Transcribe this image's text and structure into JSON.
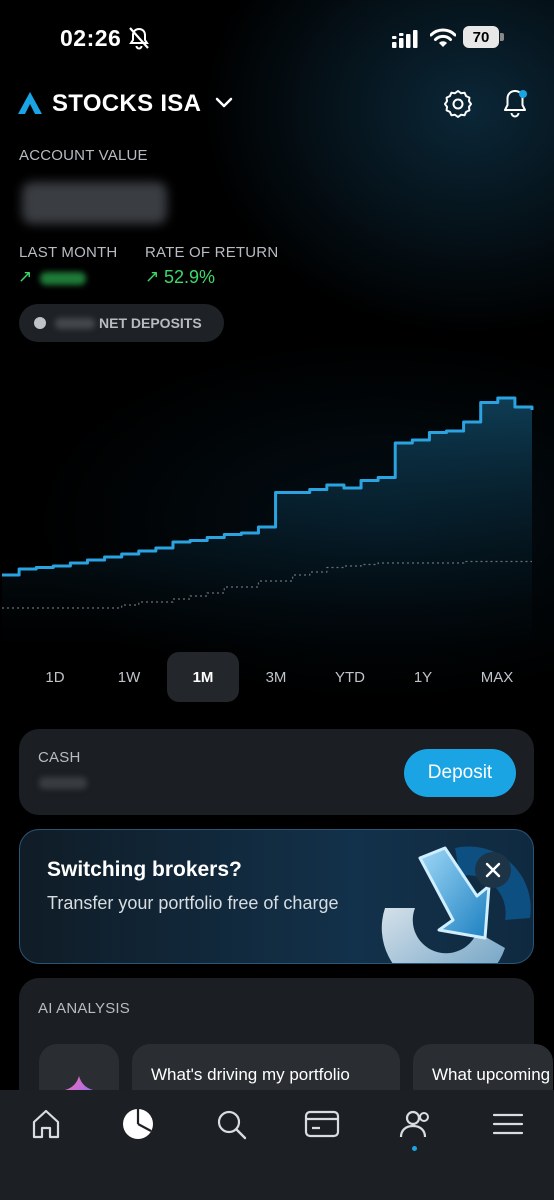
{
  "status_bar": {
    "time": "02:26",
    "battery": "70"
  },
  "header": {
    "account_name": "STOCKS ISA"
  },
  "account": {
    "value_label": "ACCOUNT VALUE",
    "last_month_label": "LAST MONTH",
    "rate_of_return_label": "RATE OF RETURN",
    "rate_of_return_value": "52.9%",
    "net_deposits_label": "NET DEPOSITS"
  },
  "chart_data": {
    "type": "line",
    "series": [
      {
        "values": [
          1.0,
          1.04,
          1.05,
          1.06,
          1.08,
          1.1,
          1.12,
          1.14,
          1.16,
          1.18,
          1.22,
          1.23,
          1.25,
          1.27,
          1.28,
          1.32,
          1.55,
          1.55,
          1.57,
          1.6,
          1.58,
          1.63,
          1.65,
          1.88,
          1.9,
          1.95,
          1.96,
          2.02,
          2.15,
          2.18,
          2.12,
          2.1
        ]
      },
      {
        "values": [
          0.78,
          0.78,
          0.78,
          0.78,
          0.78,
          0.78,
          0.78,
          0.8,
          0.82,
          0.82,
          0.84,
          0.86,
          0.88,
          0.92,
          0.92,
          0.96,
          0.96,
          1.0,
          1.02,
          1.05,
          1.06,
          1.07,
          1.08,
          1.08,
          1.08,
          1.08,
          1.08,
          1.09,
          1.09,
          1.09,
          1.09,
          1.09
        ]
      }
    ],
    "colors": {
      "value_line": "#2aa3e0",
      "deposits_line": "#6b7077"
    }
  },
  "timeframes": [
    "1D",
    "1W",
    "1M",
    "3M",
    "YTD",
    "1Y",
    "MAX"
  ],
  "timeframe_selected": "1M",
  "cash": {
    "label": "CASH",
    "deposit_label": "Deposit"
  },
  "promo": {
    "title": "Switching brokers?",
    "subtitle": "Transfer your portfolio free of charge"
  },
  "ai": {
    "label": "AI ANALYSIS",
    "questions": [
      "What's driving my portfolio today?",
      "What upcoming events could impact"
    ]
  },
  "nav": {
    "items": [
      "home-icon",
      "portfolio-icon",
      "search-icon",
      "card-icon",
      "community-icon",
      "menu-icon"
    ],
    "active": "portfolio-icon"
  },
  "colors": {
    "accent": "#1aa4e4",
    "positive": "#3ed96a",
    "background": "#000000",
    "card": "#1b1e22"
  }
}
